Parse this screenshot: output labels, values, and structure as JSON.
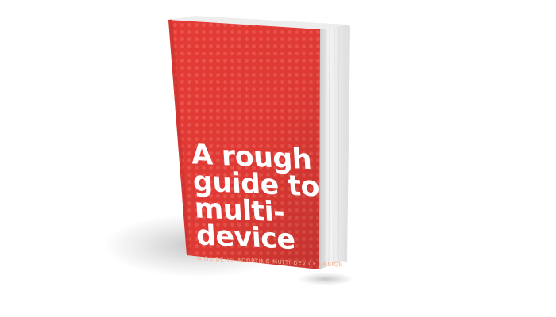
{
  "book": {
    "title_lines": [
      "A rough",
      "guide to",
      "multi-",
      "device"
    ],
    "subtitle": "A GUIDE TO ADOPTING MULTI-DEVICE DESIGN",
    "colors": {
      "cover": "#e53b36",
      "cover_dark": "#c8322e",
      "pages": "#f2f2f2",
      "title": "#ffffff",
      "subtitle": "#f0b08f",
      "background": "#ffffff"
    }
  }
}
